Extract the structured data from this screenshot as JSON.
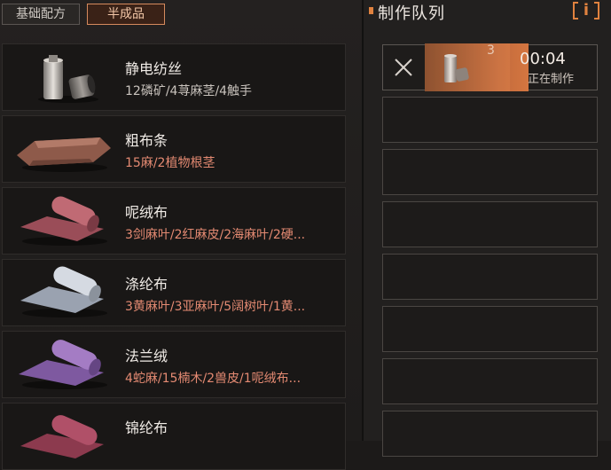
{
  "tabs": [
    {
      "label": "基础配方",
      "active": false
    },
    {
      "label": "半成品",
      "active": true
    }
  ],
  "recipes": [
    {
      "name": "静电纺丝",
      "ingredients": "12磷矿/4荨麻茎/4触手",
      "sufficient": true,
      "icon": "thread-spool-icon"
    },
    {
      "name": "粗布条",
      "ingredients": "15麻/2植物根茎",
      "sufficient": false,
      "icon": "cloth-strip-icon"
    },
    {
      "name": "呢绒布",
      "ingredients": "3剑麻叶/2红麻皮/2海麻叶/2硬...",
      "sufficient": false,
      "icon": "wool-cloth-roll-icon"
    },
    {
      "name": "涤纶布",
      "ingredients": "3黄麻叶/3亚麻叶/5阔树叶/1黄...",
      "sufficient": false,
      "icon": "polyester-cloth-roll-icon"
    },
    {
      "name": "法兰绒",
      "ingredients": "4蛇麻/15楠木/2兽皮/1呢绒布...",
      "sufficient": false,
      "icon": "flannel-roll-icon"
    },
    {
      "name": "锦纶布",
      "ingredients": "",
      "sufficient": false,
      "icon": "nylon-cloth-roll-icon"
    }
  ],
  "queue": {
    "title": "制作队列",
    "info_label": "i",
    "active": {
      "count": "3",
      "time": "00:04",
      "status": "正在制作",
      "progress": 0.82,
      "icon": "thread-spool-icon"
    },
    "empty_slots": 7
  },
  "colors": {
    "accent": "#e0823f",
    "insufficient_text": "#e48a72",
    "sufficient_text": "#c9c3bd",
    "active_tab_border": "#d58a5d"
  }
}
